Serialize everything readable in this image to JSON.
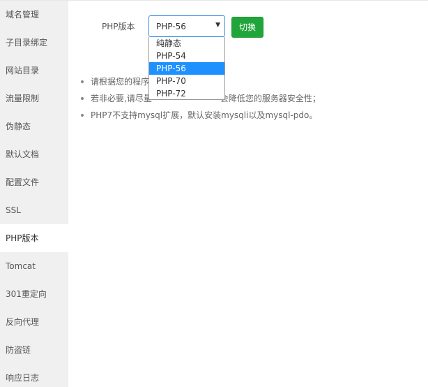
{
  "sidebar": {
    "items": [
      {
        "label": "域名管理"
      },
      {
        "label": "子目录绑定"
      },
      {
        "label": "网站目录"
      },
      {
        "label": "流量限制"
      },
      {
        "label": "伪静态"
      },
      {
        "label": "默认文档"
      },
      {
        "label": "配置文件"
      },
      {
        "label": "SSL"
      },
      {
        "label": "PHP版本"
      },
      {
        "label": "Tomcat"
      },
      {
        "label": "301重定向"
      },
      {
        "label": "反向代理"
      },
      {
        "label": "防盗链"
      },
      {
        "label": "响应日志"
      }
    ],
    "active_index": 8
  },
  "php": {
    "label": "PHP版本",
    "selected": "PHP-56",
    "switch_label": "切换",
    "options": [
      "纯静态",
      "PHP-54",
      "PHP-56",
      "PHP-70",
      "PHP-72"
    ]
  },
  "notes": [
    "请根据您的程序",
    "若非必要,请尽量",
    "PHP7不支持mysql扩展，默认安装mysqli以及mysql-pdo。"
  ],
  "notes_tail": {
    "1": "会降低您的服务器安全性；"
  },
  "colors": {
    "accent_green": "#20a53a",
    "select_blue": "#1e90ff",
    "sidebar_bg": "#f0f0f0"
  }
}
